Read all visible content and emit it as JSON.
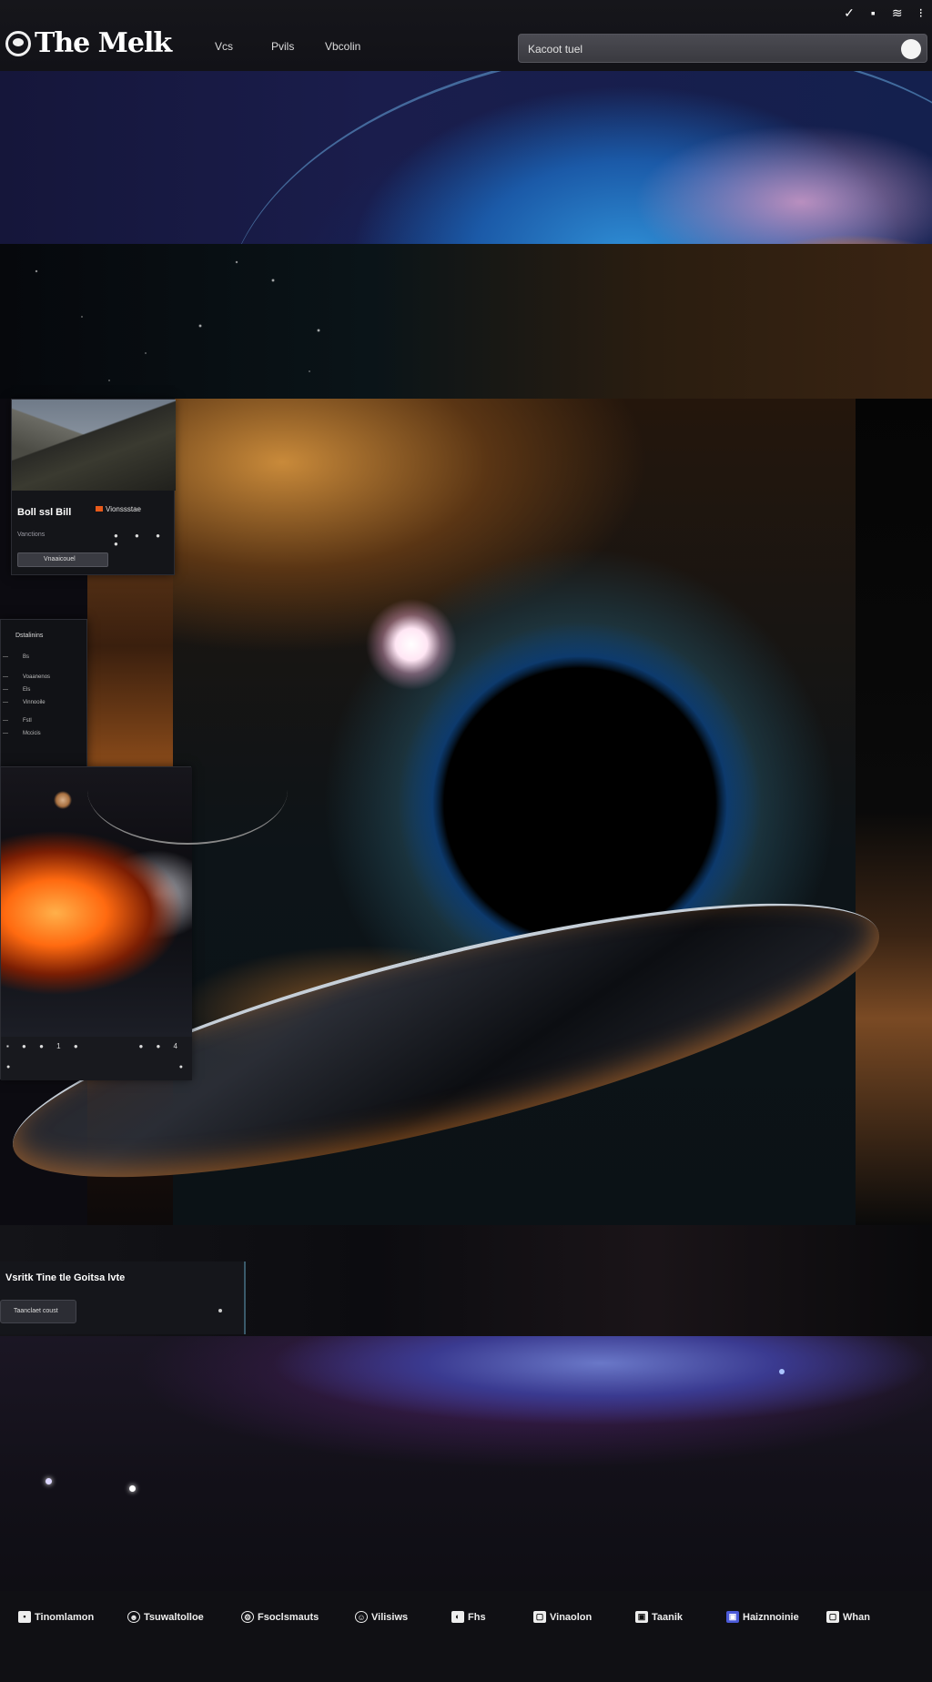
{
  "header": {
    "logo_text": "The Melk",
    "nav": [
      "Vcs",
      "Pvils",
      "Vbcolin"
    ],
    "search_placeholder": "Kacoot tuel",
    "system_icons": [
      "wifi-icon",
      "battery-icon",
      "stripes-icon",
      "dots-icon"
    ]
  },
  "cards": {
    "mountain": {
      "title": "Boll ssl Bill",
      "tag": "Vionssstae",
      "meta": "Vanctions",
      "dots": "● ● ● ●",
      "button": "Vnaaicouel"
    },
    "list": {
      "heading": "Dstalinins",
      "items": [
        {
          "k": "—",
          "v": "Bs"
        },
        {
          "k": "—",
          "v": "Voaanenos"
        },
        {
          "k": "—",
          "v": "Els"
        },
        {
          "k": "—",
          "v": "Vinnooile"
        },
        {
          "k": "—",
          "v": "Fstl"
        },
        {
          "k": "—",
          "v": "Mccicis"
        }
      ]
    },
    "fire": {
      "icons_left": "▪ ● ● 1 ●",
      "icons_right": "● ● 4",
      "small_left": "●",
      "small_right": "●"
    }
  },
  "caption": {
    "text": "Vsritk Tine tle Goitsa lvte",
    "button": "Taanclaet coust"
  },
  "footer": {
    "items": [
      {
        "icon": "square-icon",
        "label": "Tinomlamon"
      },
      {
        "icon": "mask-icon",
        "label": "Tsuwaltolloe"
      },
      {
        "icon": "gear-icon",
        "label": "Fsoclsmauts"
      },
      {
        "icon": "person-icon",
        "label": "Vilisiws"
      },
      {
        "icon": "chat-icon",
        "label": "Fhs"
      },
      {
        "icon": "frame-icon",
        "label": "Vinaolon"
      },
      {
        "icon": "box-icon",
        "label": "Taanik"
      },
      {
        "icon": "blue-square-icon",
        "label": "Haiznnoinie"
      },
      {
        "icon": "bell-icon",
        "label": "Whan"
      }
    ]
  }
}
